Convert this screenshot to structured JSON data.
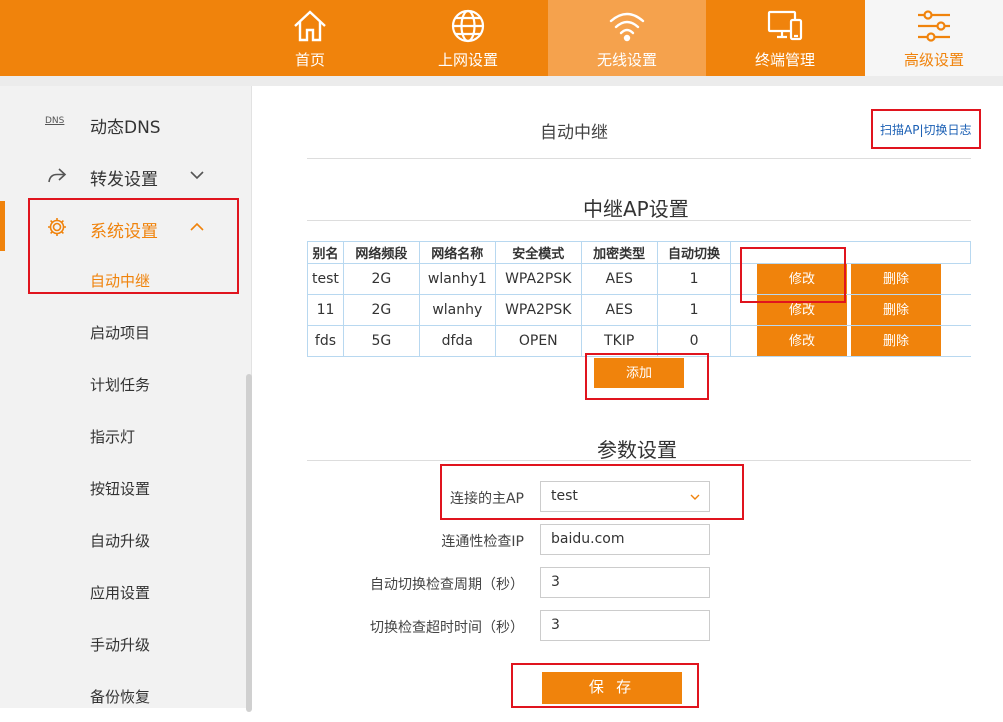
{
  "nav": {
    "items": [
      {
        "label": "首页",
        "icon": "home-icon"
      },
      {
        "label": "上网设置",
        "icon": "globe-icon"
      },
      {
        "label": "无线设置",
        "icon": "wifi-icon"
      },
      {
        "label": "终端管理",
        "icon": "devices-icon"
      },
      {
        "label": "高级设置",
        "icon": "sliders-icon"
      }
    ]
  },
  "sidebar": {
    "dns_icon_text": "DNS",
    "groups": [
      {
        "label": "动态DNS"
      },
      {
        "label": "转发设置"
      },
      {
        "label": "系统设置"
      }
    ],
    "sub_items": [
      "自动中继",
      "启动项目",
      "计划任务",
      "指示灯",
      "按钮设置",
      "自动升级",
      "应用设置",
      "手动升级",
      "备份恢复"
    ]
  },
  "main": {
    "title": "自动中继",
    "scan_link": "扫描AP|切换日志",
    "relay_title": "中继AP设置",
    "table": {
      "headers": [
        "别名",
        "网络频段",
        "网络名称",
        "安全模式",
        "加密类型",
        "自动切换"
      ],
      "rows": [
        [
          "test",
          "2G",
          "wlanhy1",
          "WPA2PSK",
          "AES",
          "1"
        ],
        [
          "11",
          "2G",
          "wlanhy",
          "WPA2PSK",
          "AES",
          "1"
        ],
        [
          "fds",
          "5G",
          "dfda",
          "OPEN",
          "TKIP",
          "0"
        ]
      ],
      "edit_label": "修改",
      "delete_label": "删除"
    },
    "add_label": "添加",
    "params_title": "参数设置",
    "form": {
      "main_ap_label": "连接的主AP",
      "main_ap_value": "test",
      "check_ip_label": "连通性检查IP",
      "check_ip_value": "baidu.com",
      "period_label": "自动切换检查周期（秒）",
      "period_value": "3",
      "timeout_label": "切换检查超时时间（秒）",
      "timeout_value": "3"
    },
    "save_label": "保 存"
  },
  "colors": {
    "accent": "#f0830c",
    "highlight": "#e0141e",
    "link": "#1a5fb4"
  }
}
